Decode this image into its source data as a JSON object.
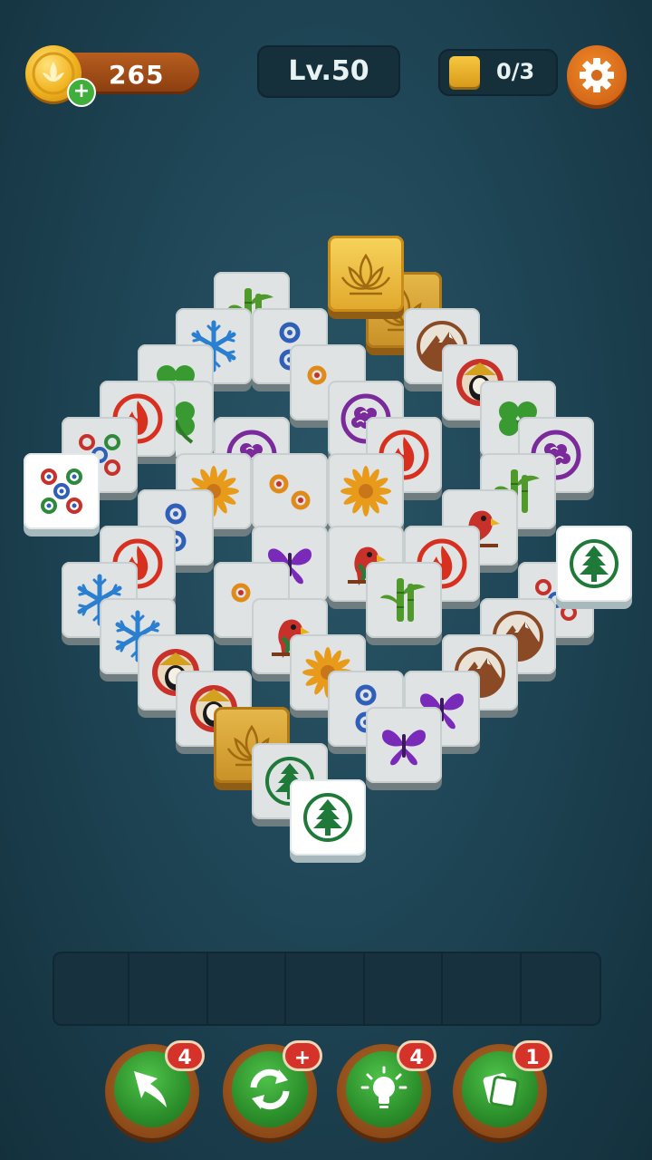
{
  "hud": {
    "coins": "265",
    "coin_add": "+",
    "level": "Lv.50",
    "goal_progress": "0/3"
  },
  "tray": {
    "slots": 7
  },
  "powerups": [
    {
      "name": "undo",
      "badge": "4"
    },
    {
      "name": "shuffle",
      "badge": "+"
    },
    {
      "name": "hint",
      "badge": "4"
    },
    {
      "name": "swap",
      "badge": "1"
    }
  ],
  "colors": {
    "background": "#1f4656",
    "coin_gold": "#f0b21d",
    "settings_orange": "#e07a22",
    "tile_face": "#dfe3e3",
    "tile_gold": "#e0a82c",
    "powerup_green": "#2c8f2b",
    "badge_red": "#d5322a"
  },
  "tiles": [
    {
      "icon": "bamboo"
    },
    {
      "icon": "blue-circles"
    },
    {
      "icon": "snowflake"
    },
    {
      "icon": "clover"
    },
    {
      "icon": "clover"
    },
    {
      "icon": "orange-circles"
    },
    {
      "icon": "mountain"
    },
    {
      "icon": "opera-mask"
    },
    {
      "icon": "gold-lotus"
    },
    {
      "icon": "gold-lotus"
    },
    {
      "icon": "purple-cloud"
    },
    {
      "icon": "red-circles"
    },
    {
      "icon": "red-five-circles"
    },
    {
      "icon": "flame"
    },
    {
      "icon": "clover"
    },
    {
      "icon": "purple-cloud"
    },
    {
      "icon": "purple-cloud"
    },
    {
      "icon": "chrysanthemum"
    },
    {
      "icon": "orange-circles"
    },
    {
      "icon": "chrysanthemum"
    },
    {
      "icon": "flame"
    },
    {
      "icon": "bamboo"
    },
    {
      "icon": "blue-circles"
    },
    {
      "icon": "parrot"
    },
    {
      "icon": "flame"
    },
    {
      "icon": "butterfly"
    },
    {
      "icon": "parrot"
    },
    {
      "icon": "flame"
    },
    {
      "icon": "pine-tree"
    },
    {
      "icon": "snowflake"
    },
    {
      "icon": "orange-circles"
    },
    {
      "icon": "bamboo"
    },
    {
      "icon": "mountain"
    },
    {
      "icon": "red-circles"
    },
    {
      "icon": "snowflake"
    },
    {
      "icon": "parrot"
    },
    {
      "icon": "opera-mask"
    },
    {
      "icon": "chrysanthemum"
    },
    {
      "icon": "blue-circles"
    },
    {
      "icon": "butterfly"
    },
    {
      "icon": "mountain"
    },
    {
      "icon": "opera-mask"
    },
    {
      "icon": "butterfly"
    },
    {
      "icon": "gold-lotus"
    },
    {
      "icon": "pine-tree"
    },
    {
      "icon": "pine-tree"
    }
  ]
}
